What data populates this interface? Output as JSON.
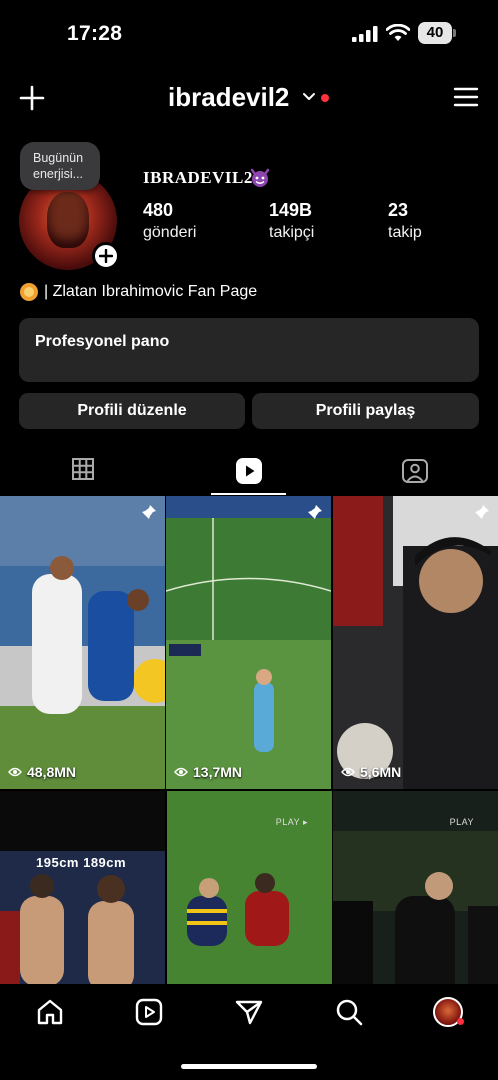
{
  "status_bar": {
    "time": "17:28",
    "battery": "40"
  },
  "header": {
    "username": "ibradevil2"
  },
  "profile": {
    "note": "Bugünün enerjisi...",
    "display_name": "IBRADEVIL2",
    "stats": [
      {
        "value": "480",
        "label": "gönderi"
      },
      {
        "value": "149B",
        "label": "takipçi"
      },
      {
        "value": "23",
        "label": "takip"
      }
    ],
    "bio": "| Zlatan Ibrahimovic Fan Page"
  },
  "professional_dashboard": {
    "label": "Profesyonel pano"
  },
  "buttons": {
    "edit_profile": "Profili düzenle",
    "share_profile": "Profili paylaş"
  },
  "tabs": [
    {
      "icon": "grid-icon"
    },
    {
      "icon": "reels-icon"
    },
    {
      "icon": "tagged-icon"
    }
  ],
  "posts": [
    {
      "views": "48,8MN",
      "pinned": true,
      "overlay_text": "",
      "colors": [
        "#2d5e9a",
        "#6a8fb5",
        "#5a8a3a"
      ]
    },
    {
      "views": "13,7MN",
      "pinned": true,
      "overlay_text": "",
      "colors": [
        "#3f7d34",
        "#5a9a45",
        "#4f8f3f"
      ]
    },
    {
      "views": "5,6MN",
      "pinned": true,
      "overlay_text": "",
      "colors": [
        "#1c1c1e",
        "#2c2c2e",
        "#3a3a3c"
      ]
    },
    {
      "views": "",
      "pinned": false,
      "overlay_text": "195cm   189cm",
      "colors": [
        "#0a0a0a",
        "#1a2a4a",
        "#7a1a1a"
      ]
    },
    {
      "views": "",
      "pinned": false,
      "overlay_text": "PLAY ▸",
      "colors": [
        "#3e7a2e",
        "#4f8f35",
        "#2e5e22"
      ]
    },
    {
      "views": "",
      "pinned": false,
      "overlay_text": "PLAY",
      "colors": [
        "#1a2a1a",
        "#2a3a2a",
        "#3a4a3a"
      ]
    }
  ],
  "bottom_nav": [
    {
      "icon": "home-icon"
    },
    {
      "icon": "reels-icon"
    },
    {
      "icon": "send-icon"
    },
    {
      "icon": "search-icon"
    },
    {
      "icon": "profile-avatar"
    }
  ]
}
